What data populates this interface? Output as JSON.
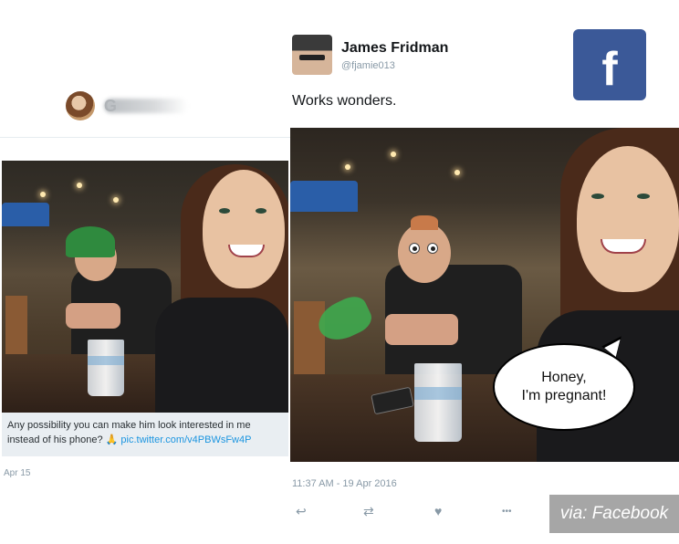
{
  "left_tweet": {
    "author_name": "G",
    "caption_text": "Any possibility you can make him look interested in me instead of his phone? ",
    "caption_emoji": "🙏",
    "caption_link": "pic.twitter.com/v4PBWsFw4P",
    "date": "Apr 15"
  },
  "right_tweet": {
    "author_name": "James Fridman",
    "author_handle": "@fjamie013",
    "text": "Works wonders.",
    "speech_bubble_line1": "Honey,",
    "speech_bubble_line2": "I'm pregnant!",
    "timestamp": "11:37 AM - 19 Apr 2016",
    "actions": {
      "reply_icon": "↩",
      "retweet_icon": "⇄",
      "like_icon": "♥",
      "more_icon": "•••"
    }
  },
  "facebook_logo_letter": "f",
  "watermark": "via: Facebook",
  "colors": {
    "facebook_blue": "#3b5998",
    "link_blue": "#1b95e0",
    "meta_gray": "#8899a6"
  }
}
